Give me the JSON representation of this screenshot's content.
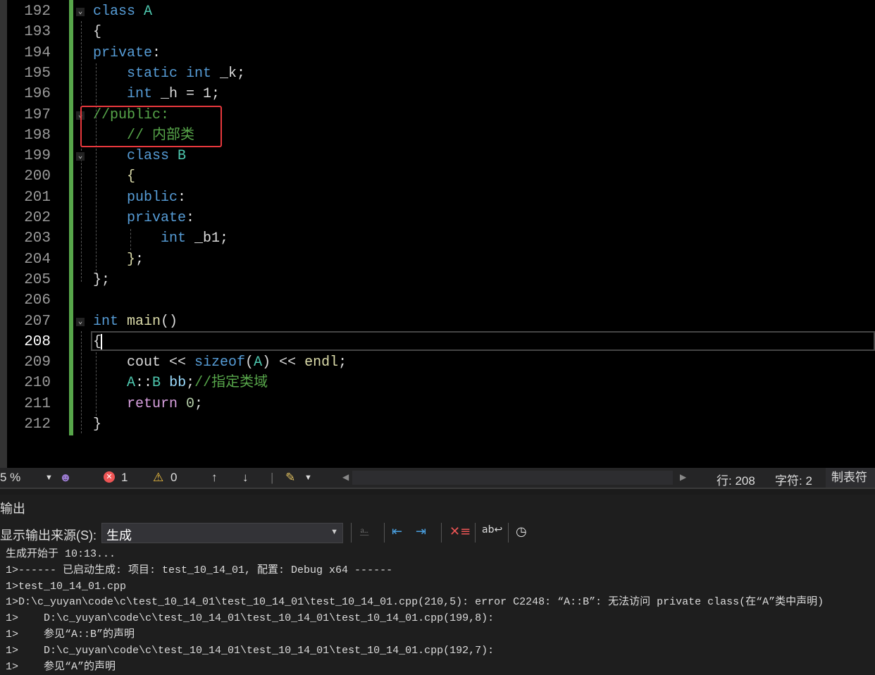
{
  "editor": {
    "lines": [
      {
        "n": "192",
        "fold": true,
        "tokens": [
          [
            "kw",
            "class "
          ],
          [
            "ty",
            "A"
          ]
        ]
      },
      {
        "n": "193",
        "tokens": [
          [
            "pl",
            "{"
          ]
        ]
      },
      {
        "n": "194",
        "tokens": [
          [
            "kw",
            "private"
          ],
          [
            "pl",
            ":"
          ]
        ]
      },
      {
        "n": "195",
        "tokens": [
          [
            "pl",
            "    "
          ],
          [
            "kw",
            "static int "
          ],
          [
            "pl",
            "_k;"
          ]
        ]
      },
      {
        "n": "196",
        "tokens": [
          [
            "pl",
            "    "
          ],
          [
            "kw",
            "int "
          ],
          [
            "pl",
            "_h = 1;"
          ]
        ]
      },
      {
        "n": "197",
        "fold": true,
        "tokens": [
          [
            "cm",
            "//public:"
          ]
        ]
      },
      {
        "n": "198",
        "tokens": [
          [
            "pl",
            "    "
          ],
          [
            "cm",
            "// 内部类"
          ]
        ]
      },
      {
        "n": "199",
        "fold": true,
        "tokens": [
          [
            "pl",
            "    "
          ],
          [
            "kw",
            "class "
          ],
          [
            "ty",
            "B"
          ]
        ]
      },
      {
        "n": "200",
        "tokens": [
          [
            "pl",
            "    "
          ],
          [
            "br",
            "{"
          ]
        ]
      },
      {
        "n": "201",
        "tokens": [
          [
            "pl",
            "    "
          ],
          [
            "kw",
            "public"
          ],
          [
            "pl",
            ":"
          ]
        ]
      },
      {
        "n": "202",
        "tokens": [
          [
            "pl",
            "    "
          ],
          [
            "kw",
            "private"
          ],
          [
            "pl",
            ":"
          ]
        ]
      },
      {
        "n": "203",
        "tokens": [
          [
            "pl",
            "        "
          ],
          [
            "kw",
            "int "
          ],
          [
            "pl",
            "_b1;"
          ]
        ]
      },
      {
        "n": "204",
        "tokens": [
          [
            "pl",
            "    "
          ],
          [
            "br",
            "}"
          ],
          [
            "pl",
            ";"
          ]
        ]
      },
      {
        "n": "205",
        "tokens": [
          [
            "pl",
            "}"
          ],
          [
            "pl",
            ";"
          ]
        ]
      },
      {
        "n": "206",
        "tokens": []
      },
      {
        "n": "207",
        "fold": true,
        "tokens": [
          [
            "kw",
            "int "
          ],
          [
            "fn",
            "main"
          ],
          [
            "pl",
            "()"
          ]
        ]
      },
      {
        "n": "208",
        "current": true,
        "tokens": [
          [
            "pl",
            "{"
          ]
        ]
      },
      {
        "n": "209",
        "tokens": [
          [
            "pl",
            "    cout << "
          ],
          [
            "kw",
            "sizeof"
          ],
          [
            "pl",
            "("
          ],
          [
            "ty",
            "A"
          ],
          [
            "pl",
            ") << "
          ],
          [
            "fn",
            "endl"
          ],
          [
            "pl",
            ";"
          ]
        ]
      },
      {
        "n": "210",
        "tokens": [
          [
            "pl",
            "    "
          ],
          [
            "ty",
            "A"
          ],
          [
            "pl",
            "::"
          ],
          [
            "ty",
            "B"
          ],
          [
            "pl",
            " "
          ],
          [
            "var",
            "bb"
          ],
          [
            "pl",
            ";"
          ],
          [
            "cm",
            "//指定类域"
          ]
        ]
      },
      {
        "n": "211",
        "tokens": [
          [
            "pl",
            "    "
          ],
          [
            "ctl",
            "return "
          ],
          [
            "num",
            "0"
          ],
          [
            "pl",
            ";"
          ]
        ]
      },
      {
        "n": "212",
        "tokens": [
          [
            "pl",
            "}"
          ]
        ]
      }
    ]
  },
  "status": {
    "zoom": "5 %",
    "errors": "1",
    "warnings": "0",
    "line": "行: 208",
    "char": "字符: 2",
    "tabs": "制表符"
  },
  "output": {
    "title": "输出",
    "source_label": "显示输出来源(S):",
    "source_value": "生成",
    "lines": [
      "生成开始于 10:13...",
      "1>------ 已启动生成: 项目: test_10_14_01, 配置: Debug x64 ------",
      "1>test_10_14_01.cpp",
      "1>D:\\c_yuyan\\code\\c\\test_10_14_01\\test_10_14_01\\test_10_14_01.cpp(210,5): error C2248: “A::B”: 无法访问 private class(在“A”类中声明)",
      "1>    D:\\c_yuyan\\code\\c\\test_10_14_01\\test_10_14_01\\test_10_14_01.cpp(199,8):",
      "1>    参见“A::B”的声明",
      "1>    D:\\c_yuyan\\code\\c\\test_10_14_01\\test_10_14_01\\test_10_14_01.cpp(192,7):",
      "1>    参见“A”的声明"
    ]
  },
  "colors": {
    "keyword": "#569cd6",
    "type": "#4ec9b0",
    "comment": "#57a64a",
    "highlight_box": "#e8383d",
    "changed_bar": "#57a64a"
  }
}
